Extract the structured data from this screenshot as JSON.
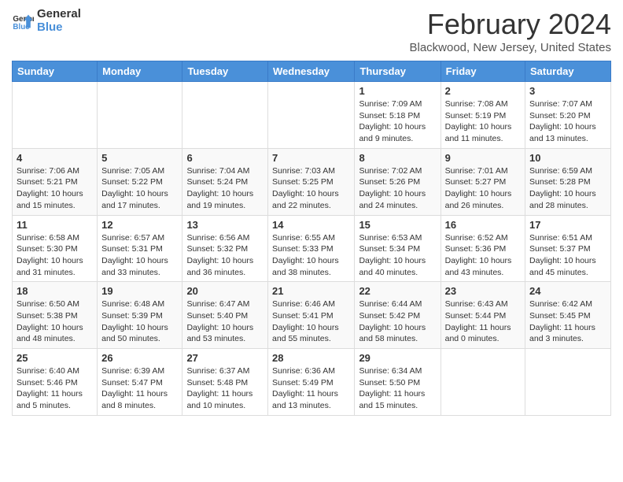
{
  "header": {
    "logo_line1": "General",
    "logo_line2": "Blue",
    "month_title": "February 2024",
    "location": "Blackwood, New Jersey, United States"
  },
  "weekdays": [
    "Sunday",
    "Monday",
    "Tuesday",
    "Wednesday",
    "Thursday",
    "Friday",
    "Saturday"
  ],
  "weeks": [
    [
      {
        "day": "",
        "info": ""
      },
      {
        "day": "",
        "info": ""
      },
      {
        "day": "",
        "info": ""
      },
      {
        "day": "",
        "info": ""
      },
      {
        "day": "1",
        "info": "Sunrise: 7:09 AM\nSunset: 5:18 PM\nDaylight: 10 hours\nand 9 minutes."
      },
      {
        "day": "2",
        "info": "Sunrise: 7:08 AM\nSunset: 5:19 PM\nDaylight: 10 hours\nand 11 minutes."
      },
      {
        "day": "3",
        "info": "Sunrise: 7:07 AM\nSunset: 5:20 PM\nDaylight: 10 hours\nand 13 minutes."
      }
    ],
    [
      {
        "day": "4",
        "info": "Sunrise: 7:06 AM\nSunset: 5:21 PM\nDaylight: 10 hours\nand 15 minutes."
      },
      {
        "day": "5",
        "info": "Sunrise: 7:05 AM\nSunset: 5:22 PM\nDaylight: 10 hours\nand 17 minutes."
      },
      {
        "day": "6",
        "info": "Sunrise: 7:04 AM\nSunset: 5:24 PM\nDaylight: 10 hours\nand 19 minutes."
      },
      {
        "day": "7",
        "info": "Sunrise: 7:03 AM\nSunset: 5:25 PM\nDaylight: 10 hours\nand 22 minutes."
      },
      {
        "day": "8",
        "info": "Sunrise: 7:02 AM\nSunset: 5:26 PM\nDaylight: 10 hours\nand 24 minutes."
      },
      {
        "day": "9",
        "info": "Sunrise: 7:01 AM\nSunset: 5:27 PM\nDaylight: 10 hours\nand 26 minutes."
      },
      {
        "day": "10",
        "info": "Sunrise: 6:59 AM\nSunset: 5:28 PM\nDaylight: 10 hours\nand 28 minutes."
      }
    ],
    [
      {
        "day": "11",
        "info": "Sunrise: 6:58 AM\nSunset: 5:30 PM\nDaylight: 10 hours\nand 31 minutes."
      },
      {
        "day": "12",
        "info": "Sunrise: 6:57 AM\nSunset: 5:31 PM\nDaylight: 10 hours\nand 33 minutes."
      },
      {
        "day": "13",
        "info": "Sunrise: 6:56 AM\nSunset: 5:32 PM\nDaylight: 10 hours\nand 36 minutes."
      },
      {
        "day": "14",
        "info": "Sunrise: 6:55 AM\nSunset: 5:33 PM\nDaylight: 10 hours\nand 38 minutes."
      },
      {
        "day": "15",
        "info": "Sunrise: 6:53 AM\nSunset: 5:34 PM\nDaylight: 10 hours\nand 40 minutes."
      },
      {
        "day": "16",
        "info": "Sunrise: 6:52 AM\nSunset: 5:36 PM\nDaylight: 10 hours\nand 43 minutes."
      },
      {
        "day": "17",
        "info": "Sunrise: 6:51 AM\nSunset: 5:37 PM\nDaylight: 10 hours\nand 45 minutes."
      }
    ],
    [
      {
        "day": "18",
        "info": "Sunrise: 6:50 AM\nSunset: 5:38 PM\nDaylight: 10 hours\nand 48 minutes."
      },
      {
        "day": "19",
        "info": "Sunrise: 6:48 AM\nSunset: 5:39 PM\nDaylight: 10 hours\nand 50 minutes."
      },
      {
        "day": "20",
        "info": "Sunrise: 6:47 AM\nSunset: 5:40 PM\nDaylight: 10 hours\nand 53 minutes."
      },
      {
        "day": "21",
        "info": "Sunrise: 6:46 AM\nSunset: 5:41 PM\nDaylight: 10 hours\nand 55 minutes."
      },
      {
        "day": "22",
        "info": "Sunrise: 6:44 AM\nSunset: 5:42 PM\nDaylight: 10 hours\nand 58 minutes."
      },
      {
        "day": "23",
        "info": "Sunrise: 6:43 AM\nSunset: 5:44 PM\nDaylight: 11 hours\nand 0 minutes."
      },
      {
        "day": "24",
        "info": "Sunrise: 6:42 AM\nSunset: 5:45 PM\nDaylight: 11 hours\nand 3 minutes."
      }
    ],
    [
      {
        "day": "25",
        "info": "Sunrise: 6:40 AM\nSunset: 5:46 PM\nDaylight: 11 hours\nand 5 minutes."
      },
      {
        "day": "26",
        "info": "Sunrise: 6:39 AM\nSunset: 5:47 PM\nDaylight: 11 hours\nand 8 minutes."
      },
      {
        "day": "27",
        "info": "Sunrise: 6:37 AM\nSunset: 5:48 PM\nDaylight: 11 hours\nand 10 minutes."
      },
      {
        "day": "28",
        "info": "Sunrise: 6:36 AM\nSunset: 5:49 PM\nDaylight: 11 hours\nand 13 minutes."
      },
      {
        "day": "29",
        "info": "Sunrise: 6:34 AM\nSunset: 5:50 PM\nDaylight: 11 hours\nand 15 minutes."
      },
      {
        "day": "",
        "info": ""
      },
      {
        "day": "",
        "info": ""
      }
    ]
  ]
}
